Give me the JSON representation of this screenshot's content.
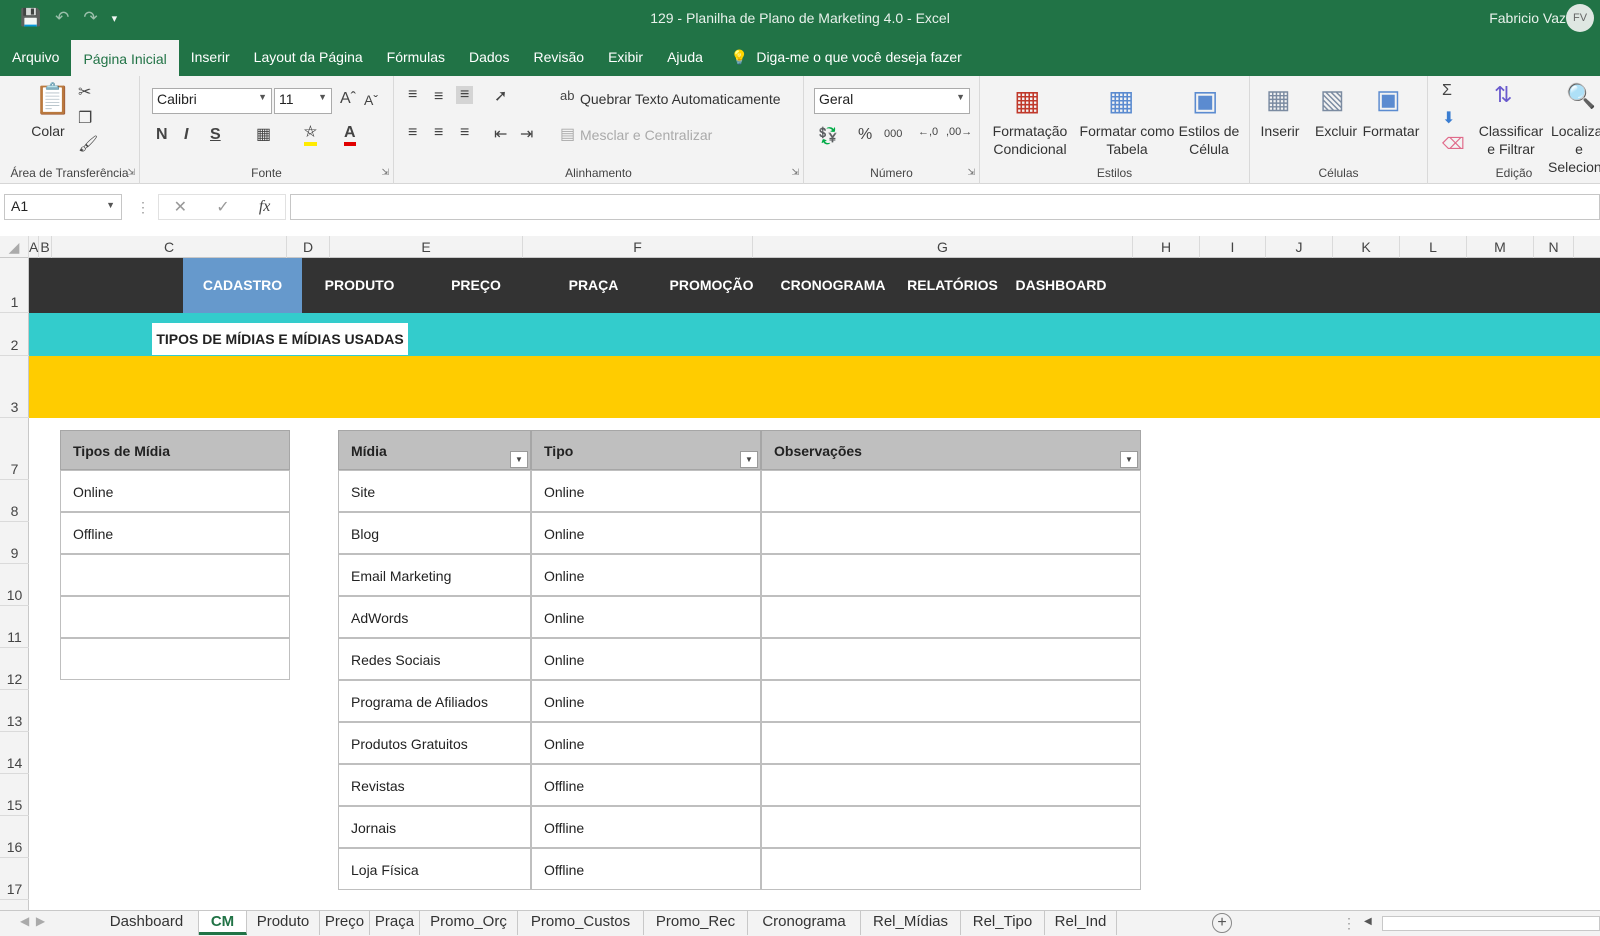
{
  "window": {
    "title": "129 - Planilha de Plano de Marketing 4.0  -  Excel",
    "user": "Fabricio Vaz",
    "avatar_initials": "FV"
  },
  "ribbon_tabs": [
    "Arquivo",
    "Página Inicial",
    "Inserir",
    "Layout da Página",
    "Fórmulas",
    "Dados",
    "Revisão",
    "Exibir",
    "Ajuda"
  ],
  "active_ribbon_tab": "Página Inicial",
  "tell_me": "Diga-me o que você deseja fazer",
  "ribbon": {
    "clipboard": {
      "paste": "Colar",
      "label": "Área de Transferência"
    },
    "font": {
      "name": "Calibri",
      "size": "11",
      "bold": "N",
      "italic": "I",
      "underline": "S",
      "label": "Fonte"
    },
    "alignment": {
      "wrap": "Quebrar Texto Automaticamente",
      "merge": "Mesclar e Centralizar",
      "label": "Alinhamento"
    },
    "number": {
      "format": "Geral",
      "label": "Número",
      "percent": "%",
      "thousands": "000"
    },
    "styles": {
      "conditional": "Formatação Condicional",
      "format_table": "Formatar como Tabela",
      "cell_styles": "Estilos de Célula",
      "label": "Estilos"
    },
    "cells": {
      "insert": "Inserir",
      "delete": "Excluir",
      "format": "Formatar",
      "label": "Células"
    },
    "editing": {
      "sort_filter": "Classificar e Filtrar",
      "find_select": "Localizar e Selecionar",
      "label": "Edição"
    }
  },
  "formula_bar": {
    "name_box": "A1",
    "fx": "fx",
    "value": ""
  },
  "columns": [
    "A",
    "B",
    "C",
    "D",
    "E",
    "F",
    "G",
    "H",
    "I",
    "J",
    "K",
    "L",
    "M",
    "N"
  ],
  "rows": [
    "1",
    "2",
    "3",
    "7",
    "8",
    "9",
    "10",
    "11",
    "12",
    "13",
    "14",
    "15",
    "16",
    "17"
  ],
  "nav_menu": [
    "CADASTRO",
    "PRODUTO",
    "PREÇO",
    "PRAÇA",
    "PROMOÇÃO",
    "CRONOGRAMA",
    "RELATÓRIOS",
    "DASHBOARD"
  ],
  "active_nav": "CADASTRO",
  "section_title": "TIPOS DE MÍDIAS E MÍDIAS USADAS",
  "media_types_table": {
    "header": "Tipos de Mídia",
    "rows": [
      "Online",
      "Offline",
      "",
      "",
      ""
    ]
  },
  "media_table": {
    "headers": [
      "Mídia",
      "Tipo",
      "Observações"
    ],
    "rows": [
      [
        "Site",
        "Online",
        ""
      ],
      [
        "Blog",
        "Online",
        ""
      ],
      [
        "Email Marketing",
        "Online",
        ""
      ],
      [
        "AdWords",
        "Online",
        ""
      ],
      [
        "Redes Sociais",
        "Online",
        ""
      ],
      [
        "Programa de Afiliados",
        "Online",
        ""
      ],
      [
        "Produtos Gratuitos",
        "Online",
        ""
      ],
      [
        "Revistas",
        "Offline",
        ""
      ],
      [
        "Jornais",
        "Offline",
        ""
      ],
      [
        "Loja Física",
        "Offline",
        ""
      ]
    ]
  },
  "sheet_tabs": [
    "Dashboard",
    "CM",
    "Produto",
    "Preço",
    "Praça",
    "Promo_Orç",
    "Promo_Custos",
    "Promo_Rec",
    "Cronograma",
    "Rel_Mídias",
    "Rel_Tipo",
    "Rel_Ind"
  ],
  "active_sheet": "CM",
  "colors": {
    "excel_green": "#217346",
    "nav_dark": "#333333",
    "nav_active": "#6699cc",
    "teal": "#33cccc",
    "yellow": "#ffcc00",
    "table_header": "#bfbfbf"
  }
}
